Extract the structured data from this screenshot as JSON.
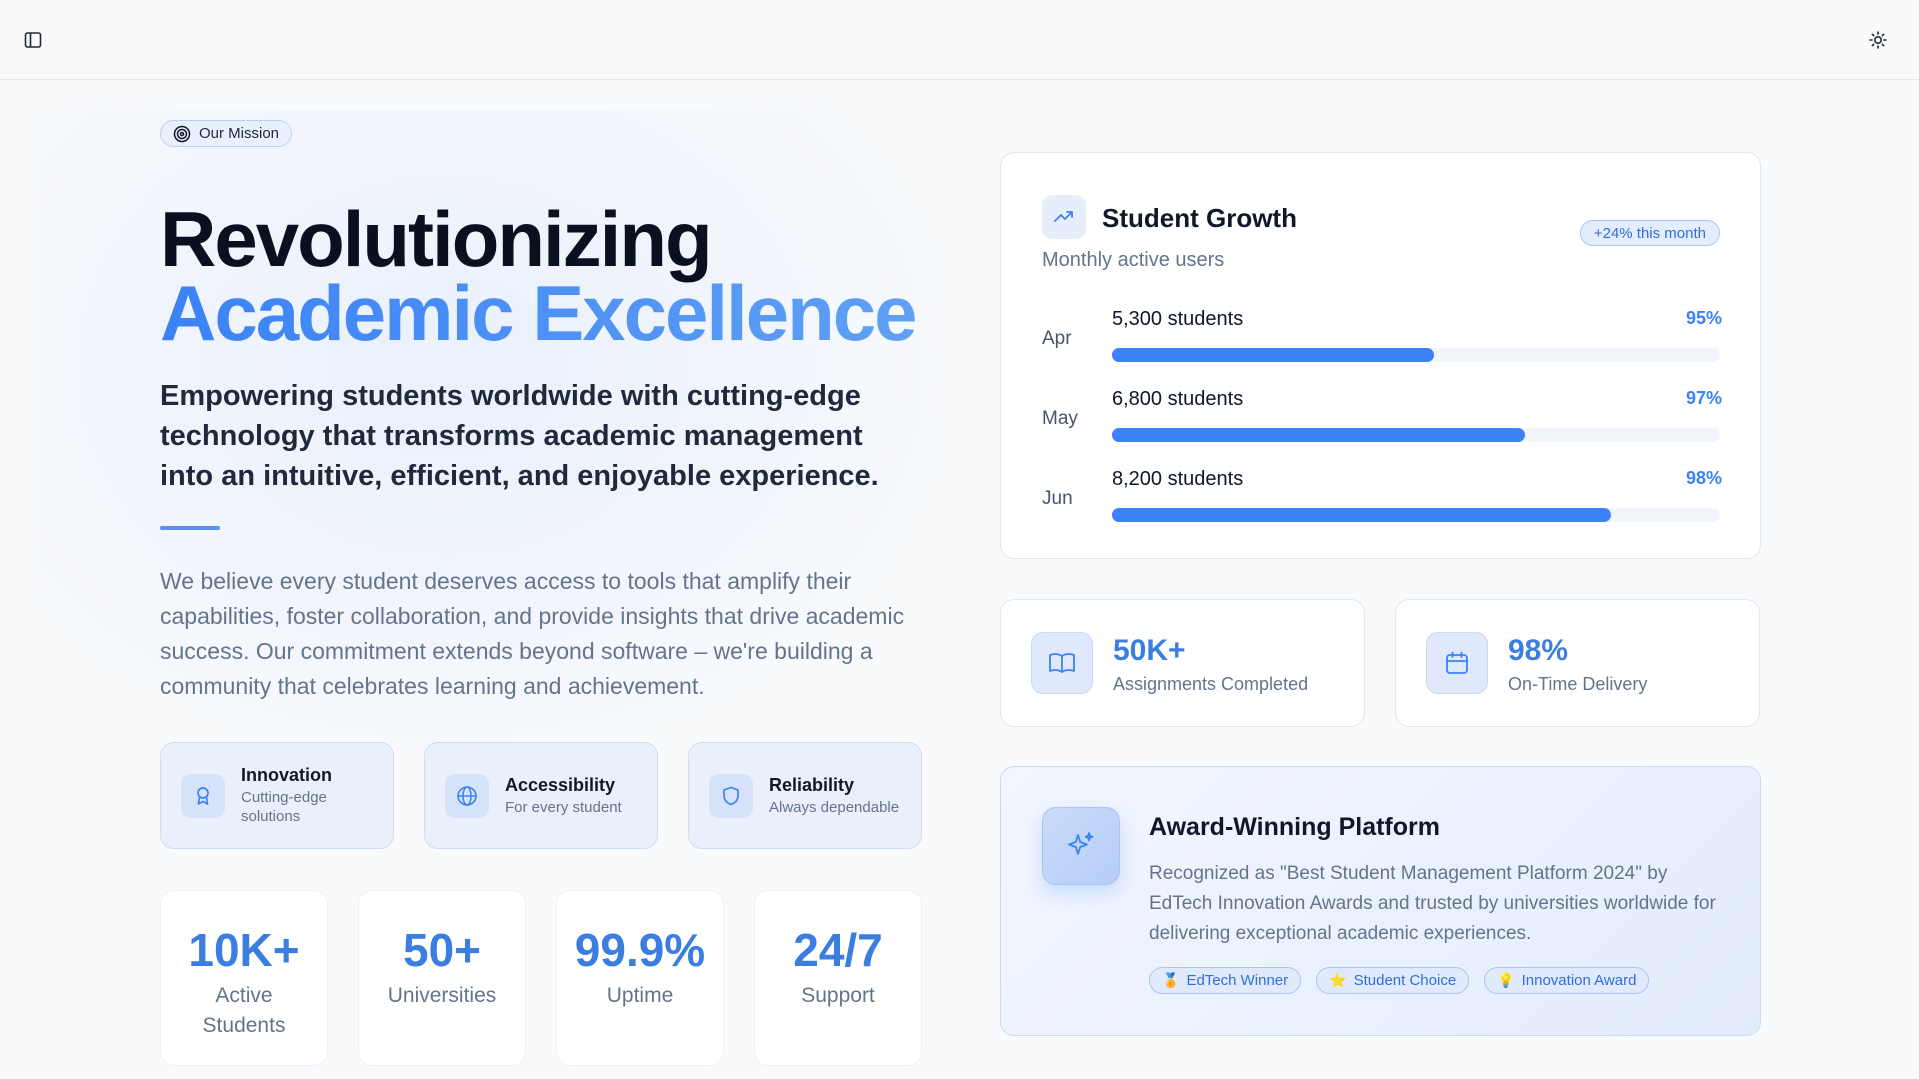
{
  "topbar": {
    "sidebar_toggle": "sidebar-toggle-icon",
    "theme_toggle": "sun-icon"
  },
  "hero": {
    "pill": "Our Mission",
    "headline_line1": "Revolutionizing",
    "headline_line2": "Academic Excellence",
    "subhead": "Empowering students worldwide with cutting-edge technology that transforms academic management into an intuitive, efficient, and enjoyable experience.",
    "paragraph": "We believe every student deserves access to tools that amplify their capabilities, foster collaboration, and provide insights that drive academic success. Our commitment extends beyond software – we're building a community that celebrates learning and achievement."
  },
  "values": [
    {
      "title": "Innovation",
      "subtitle": "Cutting-edge solutions",
      "icon": "award-ribbon-icon"
    },
    {
      "title": "Accessibility",
      "subtitle": "For every student",
      "icon": "globe-icon"
    },
    {
      "title": "Reliability",
      "subtitle": "Always dependable",
      "icon": "shield-icon"
    }
  ],
  "stats": [
    {
      "value": "10K+",
      "label": "Active Students"
    },
    {
      "value": "50+",
      "label": "Universities"
    },
    {
      "value": "99.9%",
      "label": "Uptime"
    },
    {
      "value": "24/7",
      "label": "Support"
    }
  ],
  "growth": {
    "title": "Student Growth",
    "subtitle": "Monthly active users",
    "badge": "+24% this month",
    "rows": [
      {
        "month": "Apr",
        "count": "5,300 students",
        "pct": "95%",
        "fill": 0.53
      },
      {
        "month": "May",
        "count": "6,800 students",
        "pct": "97%",
        "fill": 0.68
      },
      {
        "month": "Jun",
        "count": "8,200 students",
        "pct": "98%",
        "fill": 0.82
      }
    ]
  },
  "mini_stats": [
    {
      "value": "50K+",
      "label": "Assignments Completed",
      "icon": "book-open-icon"
    },
    {
      "value": "98%",
      "label": "On-Time Delivery",
      "icon": "calendar-icon"
    }
  ],
  "award": {
    "title": "Award-Winning Platform",
    "text": "Recognized as \"Best Student Management Platform 2024\" by EdTech Innovation Awards and trusted by universities worldwide for delivering exceptional academic experiences.",
    "tags": [
      {
        "emoji": "🏅",
        "label": "EdTech Winner"
      },
      {
        "emoji": "⭐",
        "label": "Student Choice"
      },
      {
        "emoji": "💡",
        "label": "Innovation Award"
      }
    ]
  },
  "colors": {
    "accent": "#3b82f6",
    "text": "#0f172a",
    "muted": "#64748b"
  }
}
